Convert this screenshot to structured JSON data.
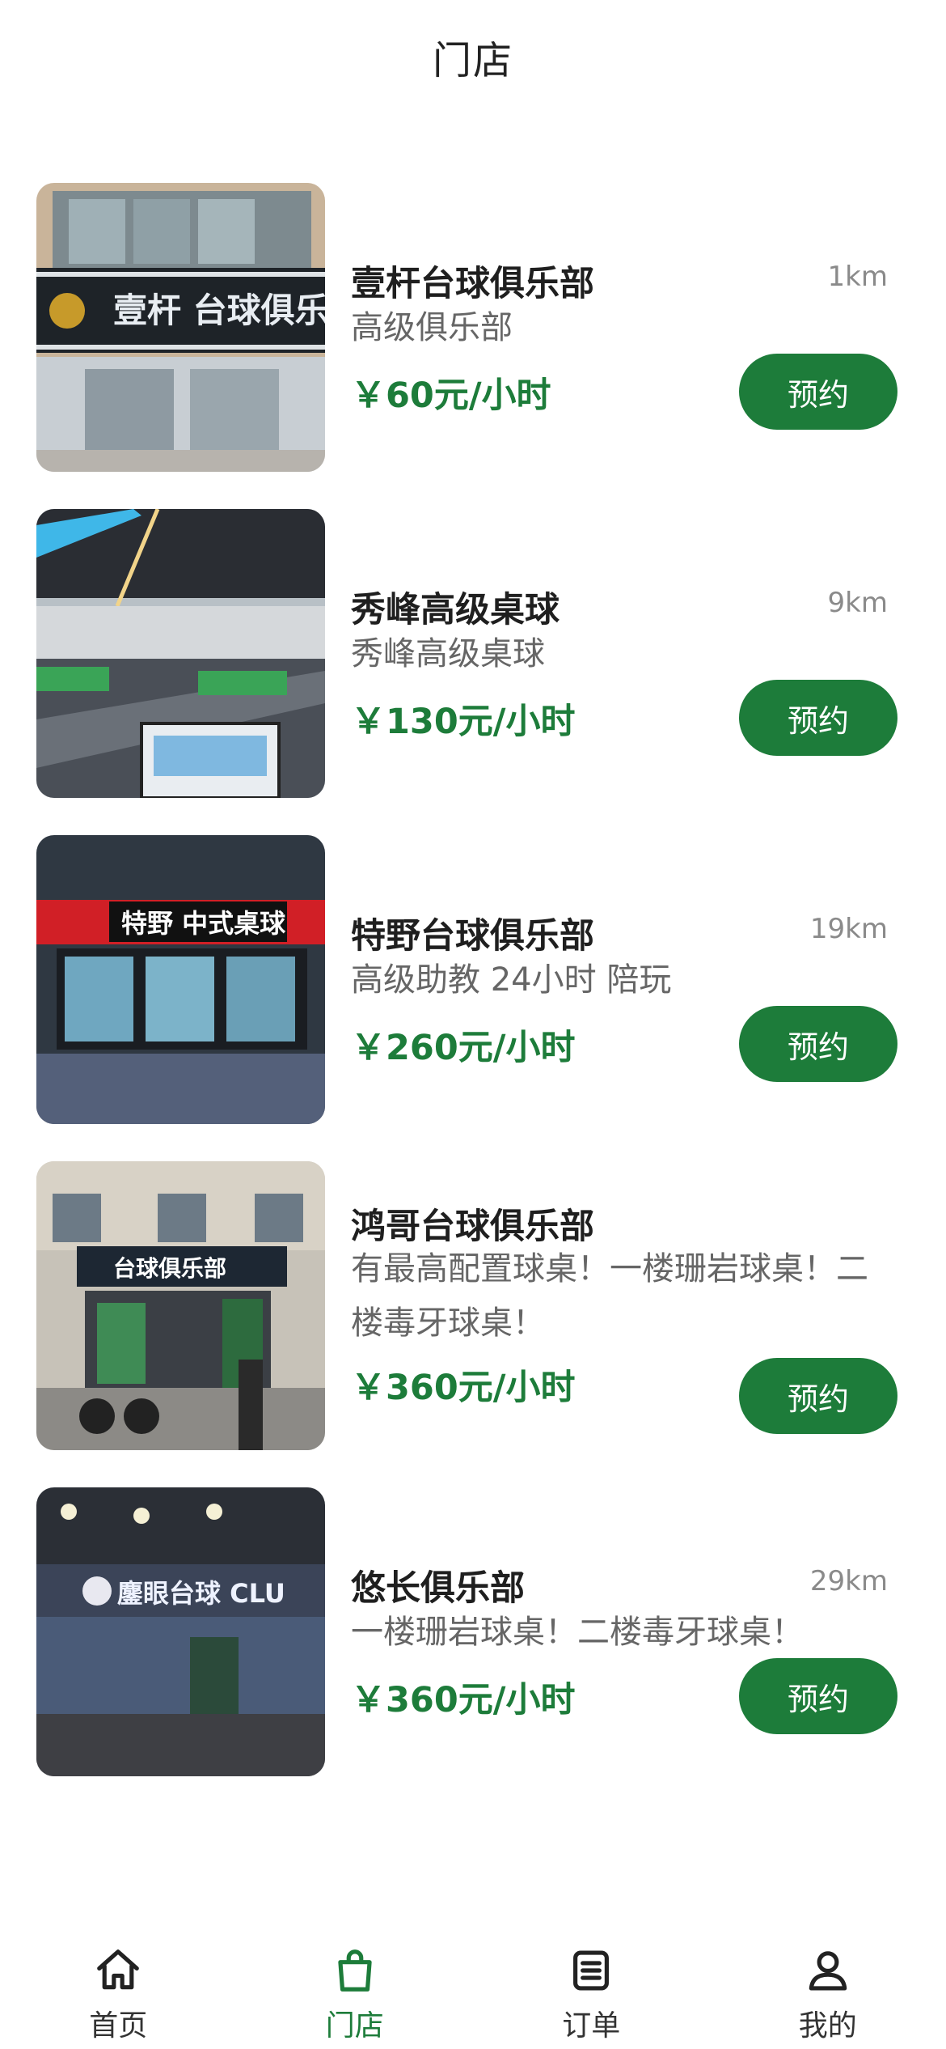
{
  "header": {
    "title": "门店"
  },
  "accent_color": "#1d7c3a",
  "stores": [
    {
      "name": "壹杆台球俱乐部",
      "distance": "1km",
      "description": "高级俱乐部",
      "price": "￥60元/小时",
      "button": "预约",
      "signage": "壹杆 台球俱乐部"
    },
    {
      "name": "秀峰高级桌球",
      "distance": "9km",
      "description": "秀峰高级桌球",
      "price": "￥130元/小时",
      "button": "预约"
    },
    {
      "name": "特野台球俱乐部",
      "distance": "19km",
      "description": "高级助教 24小时 陪玩",
      "price": "￥260元/小时",
      "button": "预约",
      "signage": "特野 中式桌球"
    },
    {
      "name": "鸿哥台球俱乐部",
      "distance": "",
      "description": "有最高配置球桌！一楼珊岩球桌！二楼毒牙球桌！",
      "price": "￥360元/小时",
      "button": "预约",
      "signage": "台球俱乐部"
    },
    {
      "name": "悠长俱乐部",
      "distance": "29km",
      "description": "一楼珊岩球桌！二楼毒牙球桌！",
      "price": "￥360元/小时",
      "button": "预约",
      "signage": "鏖眼台球 CLU"
    }
  ],
  "tabbar": [
    {
      "label": "首页",
      "icon": "home-icon",
      "active": false
    },
    {
      "label": "门店",
      "icon": "shopping-bag-icon",
      "active": true
    },
    {
      "label": "订单",
      "icon": "order-list-icon",
      "active": false
    },
    {
      "label": "我的",
      "icon": "user-icon",
      "active": false
    }
  ]
}
